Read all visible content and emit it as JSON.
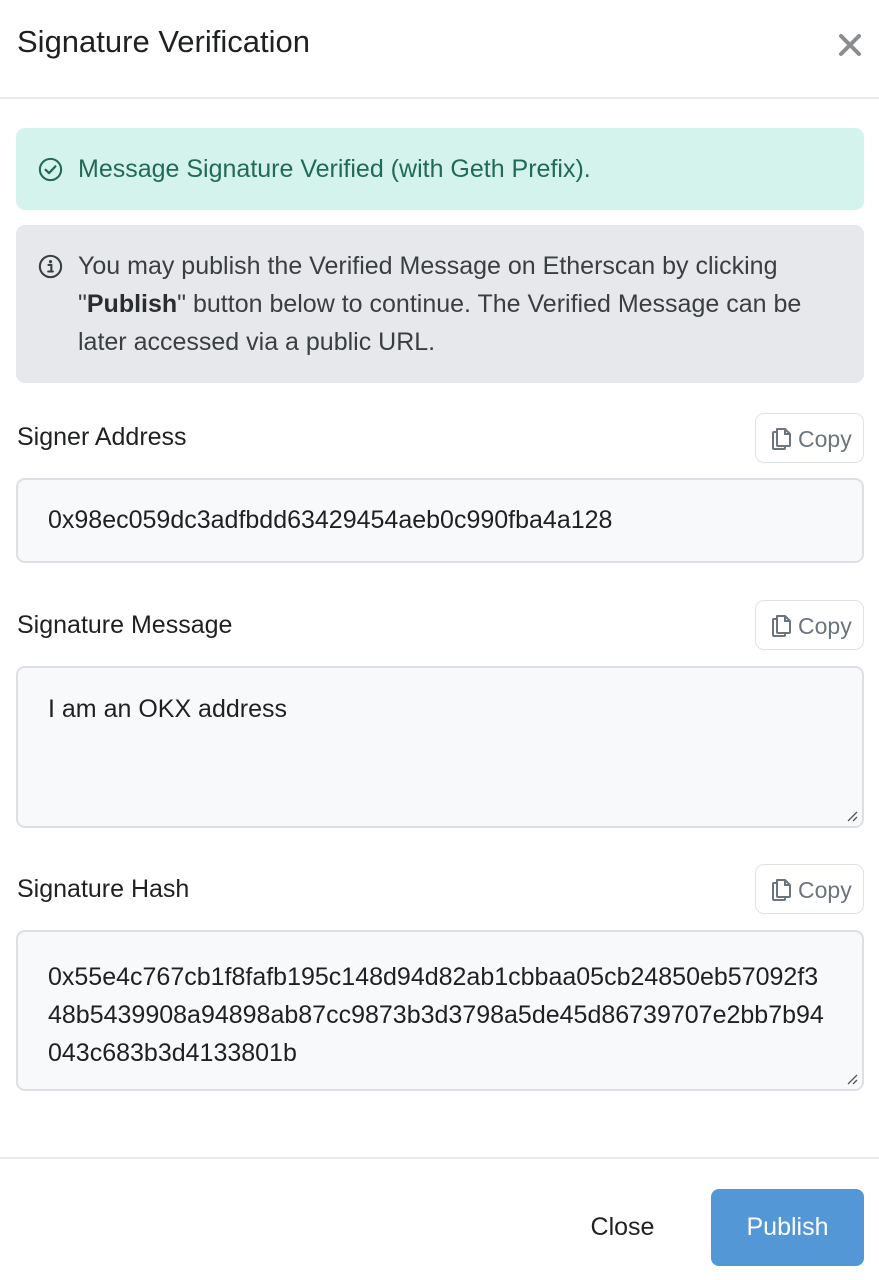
{
  "modal": {
    "title": "Signature Verification",
    "close_icon": "close-x-icon"
  },
  "alerts": {
    "success": {
      "icon": "check-circle-icon",
      "text": "Message Signature Verified (with Geth Prefix).",
      "color": "#226a57",
      "background": "#d4f3ec"
    },
    "info": {
      "icon": "info-circle-icon",
      "text_before": "You may publish the Verified Message on Etherscan by clicking \"",
      "text_bold": "Publish",
      "text_after": "\" button below to continue. The Verified Message can be later accessed via a public URL.",
      "background": "#e6e8ec"
    }
  },
  "fields": {
    "signer_address": {
      "label": "Signer Address",
      "copy_label": "Copy",
      "value": "0x98ec059dc3adfbdd63429454aeb0c990fba4a128"
    },
    "signature_message": {
      "label": "Signature Message",
      "copy_label": "Copy",
      "value": "I am an OKX address"
    },
    "signature_hash": {
      "label": "Signature Hash",
      "copy_label": "Copy",
      "value": "0x55e4c767cb1f8fafb195c148d94d82ab1cbbaa05cb24850eb57092f348b5439908a94898ab87cc9873b3d3798a5de45d86739707e2bb7b94043c683b3d4133801b"
    }
  },
  "footer": {
    "close_label": "Close",
    "publish_label": "Publish",
    "publish_color": "#5397d6"
  }
}
